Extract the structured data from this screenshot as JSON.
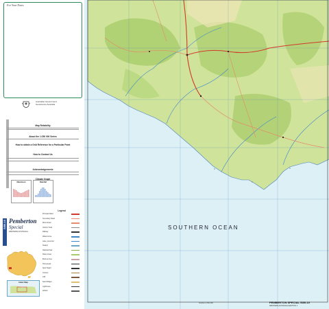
{
  "notes_panel": {
    "title": "For Your Notes"
  },
  "government": {
    "line1": "Australian Government",
    "line2": "Geoscience Australia"
  },
  "sections": {
    "map_reliability": "Map Reliability",
    "about_series": "About the 1:250 000 Series",
    "use_grid": "How to obtain a Grid Reference for a Particular Point",
    "how_to_contact": "How to Contact Us",
    "acknowledgements": "Acknowledgements",
    "climate_graph": "Climate Graph",
    "index_map": "Index Map",
    "legend": "Legend"
  },
  "climate": {
    "left_label": "Maximum",
    "right_label": "Rainfall"
  },
  "sheet": {
    "name": "Pemberton",
    "special": "Special",
    "state": "WESTERN AUSTRALIA",
    "code": "SI50-10"
  },
  "map": {
    "ocean_label": "SOUTHERN OCEAN",
    "title_block": "PEMBERTON SPECIAL SI50-10",
    "subtitle_block": "WESTERN AUSTRALIA  EDITION 1",
    "scale": "SCALE 1:250 000",
    "colors": {
      "sea": "#dcf0f5",
      "land": "#cfe49a",
      "forest": "#a9cc6b",
      "road_major": "#d0392b",
      "road_minor": "#e58a6a",
      "grid": "#4a7fc1",
      "notes_border": "#2e8b57"
    }
  },
  "legend_items": [
    {
      "label": "Principal Road"
    },
    {
      "label": "Secondary Road"
    },
    {
      "label": "Minor Road"
    },
    {
      "label": "Vehicle Track"
    },
    {
      "label": "Railway"
    },
    {
      "label": "Watercourse"
    },
    {
      "label": "Lake, perennial"
    },
    {
      "label": "Swamp"
    },
    {
      "label": "National Park"
    },
    {
      "label": "State Forest"
    },
    {
      "label": "Built-up Area"
    },
    {
      "label": "Homestead"
    },
    {
      "label": "Spot Height"
    },
    {
      "label": "Contour"
    },
    {
      "label": "Cliff"
    },
    {
      "label": "Sand Ridges"
    },
    {
      "label": "Lighthouse"
    },
    {
      "label": "Airfield"
    }
  ]
}
